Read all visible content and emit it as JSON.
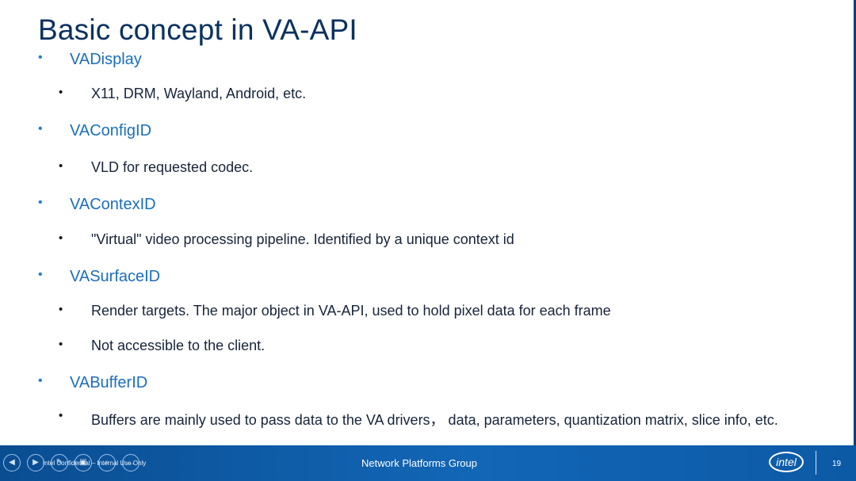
{
  "slide": {
    "title": "Basic concept in VA-API",
    "bullets": [
      {
        "level": 1,
        "text": "VADisplay"
      },
      {
        "level": 2,
        "text": "X11, DRM, Wayland, Android, etc."
      },
      {
        "level": 1,
        "text": "VAConfigID"
      },
      {
        "level": 2,
        "text": "VLD for requested codec."
      },
      {
        "level": 1,
        "text": "VAContexID"
      },
      {
        "level": 2,
        "text": "\"Virtual\" video processing pipeline. Identified by a unique context id"
      },
      {
        "level": 1,
        "text": "VASurfaceID"
      },
      {
        "level": 2,
        "text": "Render targets. The major object in VA-API, used to hold pixel data for each frame"
      },
      {
        "level": 2,
        "text": "Not accessible to the client."
      },
      {
        "level": 1,
        "text": "VABufferID"
      },
      {
        "level": 2,
        "text": "Buffers are mainly used to pass data to the VA drivers， data, parameters, quantization matrix, slice info, etc."
      }
    ],
    "bullet_glyph": "•"
  },
  "footer": {
    "confidential": "Intel Confidential – Internal Use Only",
    "group": "Network Platforms Group",
    "logo_text": "intel",
    "page_number": "19"
  },
  "controls": [
    {
      "name": "previous-slide-icon",
      "glyph": "◀"
    },
    {
      "name": "next-slide-icon",
      "glyph": "▶"
    },
    {
      "name": "pen-icon",
      "glyph": "✎"
    },
    {
      "name": "slides-icon",
      "glyph": "▣"
    },
    {
      "name": "zoom-icon",
      "glyph": "⌕"
    },
    {
      "name": "more-icon",
      "glyph": "…"
    }
  ],
  "colors": {
    "title": "#0b3160",
    "level1": "#1a6fbc",
    "level2": "#16243a",
    "footer": "#0a4d91"
  }
}
